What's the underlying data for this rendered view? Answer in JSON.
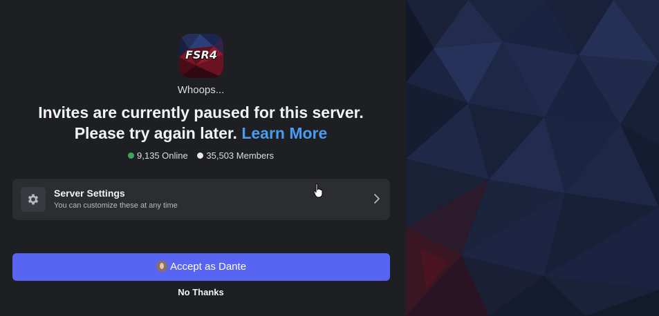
{
  "server": {
    "icon_label": "FSR4",
    "icon_name": "server-fsr4-icon"
  },
  "invite": {
    "subtitle": "Whoops...",
    "headline": "Invites are currently paused for this server. Please try again later.",
    "learn_more": "Learn More"
  },
  "stats": {
    "online": "9,135 Online",
    "members": "35,503 Members",
    "online_color": "#3ba55d",
    "members_color": "#e8e8ea"
  },
  "settings_card": {
    "title": "Server Settings",
    "description": "You can customize these at any time",
    "icon": "gear-icon"
  },
  "actions": {
    "accept_label": "Accept as Dante",
    "decline_label": "No Thanks"
  },
  "colors": {
    "accent": "#5865f2",
    "link": "#4a9cf2",
    "background": "#1e1f22",
    "card": "#2b2d31"
  }
}
